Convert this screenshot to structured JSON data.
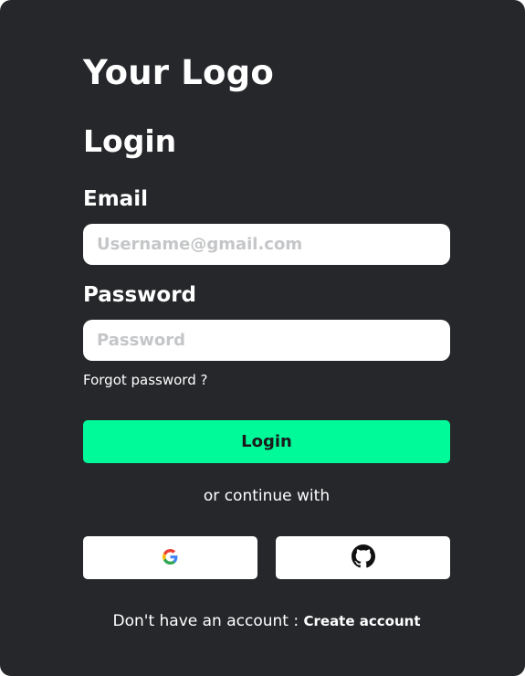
{
  "brand": {
    "logo_text": "Your Logo"
  },
  "form": {
    "title": "Login",
    "email": {
      "label": "Email",
      "placeholder": "Username@gmail.com",
      "value": ""
    },
    "password": {
      "label": "Password",
      "placeholder": "Password",
      "value": ""
    },
    "forgot_link": "Forgot password ?",
    "submit_label": "Login"
  },
  "social": {
    "divider_text": "or continue with",
    "providers": [
      {
        "icon": "google-icon"
      },
      {
        "icon": "github-icon"
      }
    ]
  },
  "footer": {
    "prompt": "Don't have an account :",
    "create_link": "Create account"
  },
  "colors": {
    "background": "#25272a",
    "accent": "#00fa9a",
    "text": "#ffffff",
    "placeholder": "#c5c6c8"
  }
}
